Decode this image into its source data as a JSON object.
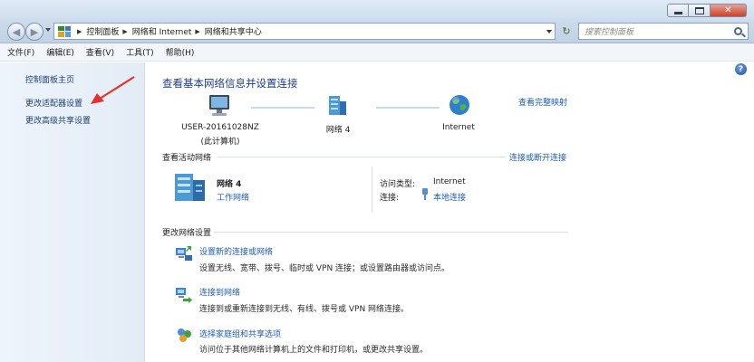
{
  "addressbar": {
    "crumbs": [
      "控制面板",
      "网络和 Internet",
      "网络和共享中心"
    ],
    "search_placeholder": "搜索控制面板"
  },
  "menu": [
    "文件(F)",
    "编辑(E)",
    "查看(V)",
    "工具(T)",
    "帮助(H)"
  ],
  "sidebar": {
    "items": [
      "控制面板主页",
      "更改适配器设置",
      "更改高级共享设置"
    ]
  },
  "main": {
    "title": "查看基本网络信息并设置连接",
    "see_full_map": "查看完整映射",
    "nodes": [
      {
        "label": "USER-20161028NZ",
        "sublabel": "(此计算机)",
        "icon": "computer-icon"
      },
      {
        "label": "网络  4",
        "icon": "network-building-icon"
      },
      {
        "label": "Internet",
        "icon": "globe-icon"
      }
    ],
    "active_networks": {
      "heading": "查看活动网络",
      "connect_link": "连接或断开连接",
      "network_name": "网络  4",
      "network_type": "工作网络",
      "access_type_label": "访问类型:",
      "access_type_value": "Internet",
      "connection_label": "连接:",
      "connection_value": "本地连接"
    },
    "change_settings": {
      "heading": "更改网络设置",
      "tasks": [
        {
          "title": "设置新的连接或网络",
          "desc": "设置无线、宽带、拨号、临时或 VPN 连接；或设置路由器或访问点。",
          "icon": "new-connection-icon"
        },
        {
          "title": "连接到网络",
          "desc": "连接到或重新连接到无线、有线、拨号或 VPN 网络连接。",
          "icon": "connect-network-icon"
        },
        {
          "title": "选择家庭组和共享选项",
          "desc": "访问位于其他网络计算机上的文件和打印机，或更改共享设置。",
          "icon": "homegroup-icon"
        }
      ]
    }
  },
  "colors": {
    "link": "#1f5cb3",
    "title": "#1f3d84",
    "sidebar_bg": "#e9f0f8",
    "annotation_arrow": "#e8302a"
  }
}
